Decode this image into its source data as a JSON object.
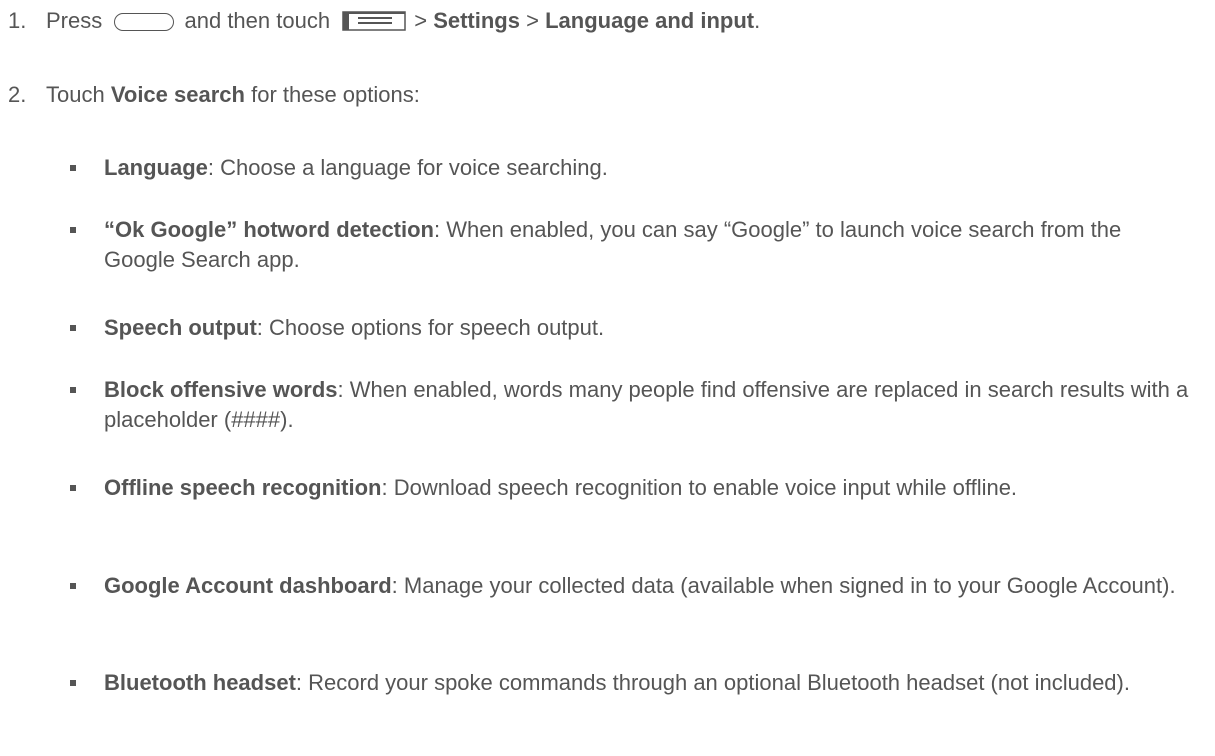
{
  "step1": {
    "number": "1.",
    "press": "Press",
    "home_key_icon": "home-key-icon",
    "then_touch": "and then touch",
    "menu_key_icon": "menu-key-icon",
    "sep1": ">",
    "settings": "Settings",
    "sep2": ">",
    "language_input": "Language and input",
    "end": "."
  },
  "step2": {
    "number": "2.",
    "touch": "Touch",
    "voice_search": "Voice search",
    "rest": "for these options:"
  },
  "options": [
    {
      "term": "Language",
      "desc": ": Choose a language for voice searching."
    },
    {
      "term": "“Ok Google” hotword detection",
      "desc": ": When enabled, you can say “Google” to launch voice search from the Google Search app."
    },
    {
      "term": "Speech output",
      "desc": ": Choose options for speech output."
    },
    {
      "term": "Block offensive words",
      "desc": ": When enabled, words many people find offensive are replaced in search results with a placeholder (####)."
    },
    {
      "term": "Offline speech recognition",
      "desc": ": Download speech recognition to enable voice input while offline."
    },
    {
      "term": "Google Account dashboard",
      "desc": ": Manage your collected data (available when signed in to your Google Account)."
    },
    {
      "term": "Bluetooth headset",
      "desc": ": Record your spoke commands through an optional Bluetooth headset (not included)."
    }
  ]
}
